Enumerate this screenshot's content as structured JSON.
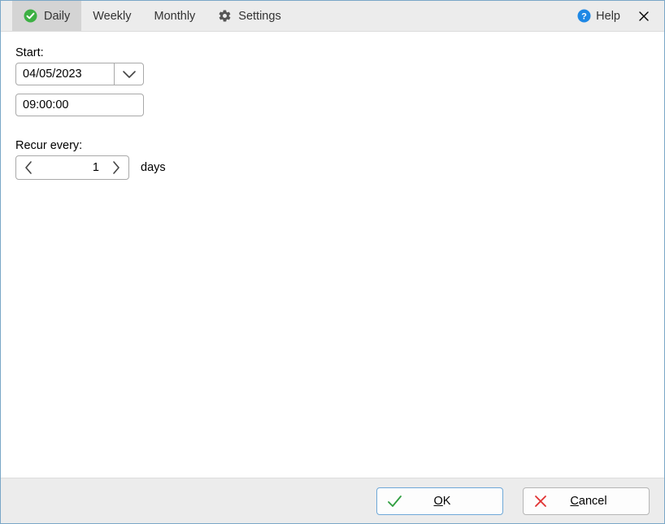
{
  "tabs": {
    "daily": {
      "label": "Daily",
      "selected": true
    },
    "weekly": {
      "label": "Weekly",
      "selected": false
    },
    "monthly": {
      "label": "Monthly",
      "selected": false
    },
    "settings": {
      "label": "Settings",
      "selected": false
    }
  },
  "help_label": "Help",
  "start": {
    "label": "Start:",
    "date": "04/05/2023",
    "time": "09:00:00"
  },
  "recur": {
    "label": "Recur every:",
    "value": "1",
    "unit": "days"
  },
  "buttons": {
    "ok": {
      "label_pre": "",
      "label_u": "O",
      "label_post": "K"
    },
    "cancel": {
      "label_pre": "",
      "label_u": "C",
      "label_post": "ancel"
    }
  },
  "colors": {
    "accent_green": "#3cb043",
    "help_blue": "#1e88e5",
    "ok_green": "#2e9e3f",
    "cancel_red": "#e03131"
  }
}
